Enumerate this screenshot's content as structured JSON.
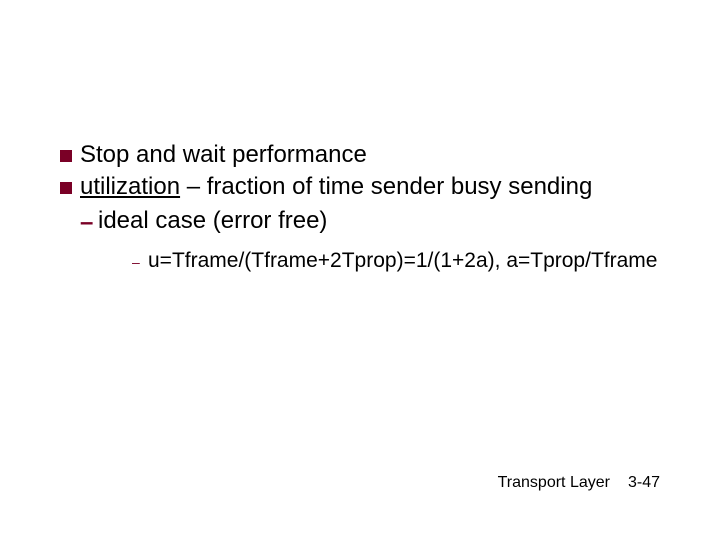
{
  "bullets": {
    "b1": "Stop and wait performance",
    "b2_underlined": "utilization",
    "b2_rest": " – fraction of time sender busy sending",
    "dash1": "ideal case (error free)",
    "sub1": "u=Tframe/(Tframe+2Tprop)=1/(1+2a), a=Tprop/Tframe"
  },
  "footer": {
    "label": "Transport Layer",
    "page": "3-47"
  }
}
